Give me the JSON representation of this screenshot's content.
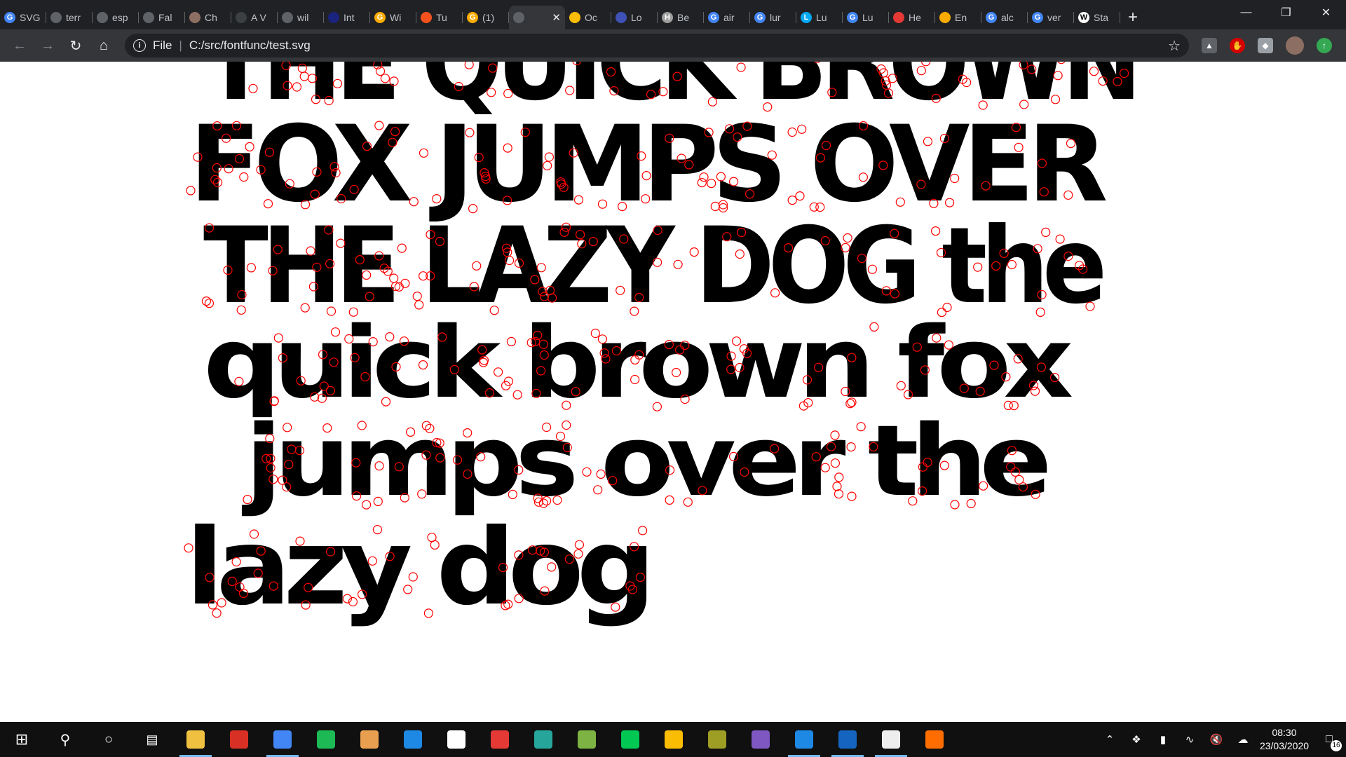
{
  "tabs": [
    {
      "title": "SVG",
      "color": "#4285f4"
    },
    {
      "title": "terr",
      "color": "#5f6368"
    },
    {
      "title": "esp",
      "color": "#5f6368"
    },
    {
      "title": "Fal",
      "color": "#5f6368"
    },
    {
      "title": "Ch",
      "color": "#8d6e63"
    },
    {
      "title": "A V",
      "color": "#3c4043"
    },
    {
      "title": "wil",
      "color": "#5f6368"
    },
    {
      "title": "Int",
      "color": "#1a237e"
    },
    {
      "title": "Wi",
      "color": "#f9ab00"
    },
    {
      "title": "Tu",
      "color": "#f4511e"
    },
    {
      "title": "(1)",
      "color": "#f9ab00"
    },
    {
      "title": "",
      "color": "#5f6368",
      "active": true
    },
    {
      "title": "Oc",
      "color": "#fbbc04"
    },
    {
      "title": "Lo",
      "color": "#3f51b5"
    },
    {
      "title": "Be",
      "color": "#9e9e9e"
    },
    {
      "title": "air",
      "color": "#4285f4"
    },
    {
      "title": "lur",
      "color": "#4285f4"
    },
    {
      "title": "Lu",
      "color": "#03a9f4"
    },
    {
      "title": "Lu",
      "color": "#4285f4"
    },
    {
      "title": "He",
      "color": "#e53935"
    },
    {
      "title": "En",
      "color": "#f9ab00"
    },
    {
      "title": "alc",
      "color": "#4285f4"
    },
    {
      "title": "ver",
      "color": "#4285f4"
    },
    {
      "title": "Sta",
      "color": "#ffffff"
    }
  ],
  "tab_icons": [
    "G",
    "",
    "",
    "",
    "",
    "",
    "",
    "",
    "G",
    "",
    "G",
    "",
    "",
    "",
    "H",
    "G",
    "G",
    "L",
    "G",
    "",
    "",
    "G",
    "G",
    "W"
  ],
  "address": {
    "scheme_label": "File",
    "url": "C:/src/fontfunc/test.svg"
  },
  "content": {
    "lines": [
      "THE QUICK BROWN",
      "FOX JUMPS OVER",
      "THE LAZY DOG the",
      "quick brown fox",
      "jumps over the",
      "lazy dog"
    ]
  },
  "taskbar": {
    "apps": [
      {
        "name": "file-explorer",
        "color": "#f0c040",
        "running": true
      },
      {
        "name": "gmail",
        "color": "#d93025",
        "running": false
      },
      {
        "name": "chrome",
        "color": "#4285f4",
        "running": true
      },
      {
        "name": "spotify",
        "color": "#1db954",
        "running": false
      },
      {
        "name": "fontforge",
        "color": "#e8a050",
        "running": false
      },
      {
        "name": "ccleaner",
        "color": "#1e88e5",
        "running": false
      },
      {
        "name": "notepad",
        "color": "#ffffff",
        "running": false
      },
      {
        "name": "xmind",
        "color": "#e53935",
        "running": false
      },
      {
        "name": "terminal",
        "color": "#26a69a",
        "running": false
      },
      {
        "name": "minecraft",
        "color": "#7cb342",
        "running": false
      },
      {
        "name": "app-green",
        "color": "#00c853",
        "running": false
      },
      {
        "name": "keep",
        "color": "#fbbc04",
        "running": false
      },
      {
        "name": "blender-globe",
        "color": "#9e9d24",
        "running": false
      },
      {
        "name": "visual-studio",
        "color": "#7e57c2",
        "running": false
      },
      {
        "name": "vscode",
        "color": "#1e88e5",
        "running": true
      },
      {
        "name": "app-blue",
        "color": "#1565c0",
        "running": true
      },
      {
        "name": "photos",
        "color": "#eeeeee",
        "running": true
      },
      {
        "name": "blender",
        "color": "#ff6d00",
        "running": false
      }
    ],
    "clock_time": "08:30",
    "clock_date": "23/03/2020",
    "notification_count": "16"
  }
}
